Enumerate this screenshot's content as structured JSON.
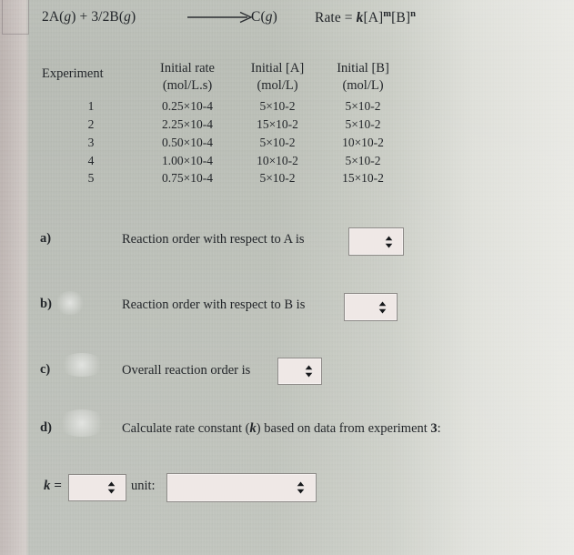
{
  "equation": {
    "reactants": "2A(g) + 3/2B(g)",
    "arrow_icon": "right-arrow-icon",
    "product": "C(g)",
    "rate_law_prefix": "Rate = ",
    "rate_law_k": "k",
    "rate_law_a": "[A]",
    "rate_law_m": "m",
    "rate_law_b": "[B]",
    "rate_law_n": "n"
  },
  "table": {
    "headers": [
      {
        "line1": "Experiment",
        "line2": ""
      },
      {
        "line1": "Initial rate",
        "line2": "(mol/L.s)"
      },
      {
        "line1": "Initial [A]",
        "line2": "(mol/L)"
      },
      {
        "line1": "Initial [B]",
        "line2": "(mol/L)"
      }
    ],
    "rows": [
      {
        "experiment": "1",
        "rate": "0.25×10-4",
        "a": "5×10-2",
        "b": "5×10-2"
      },
      {
        "experiment": "2",
        "rate": "2.25×10-4",
        "a": "15×10-2",
        "b": "5×10-2"
      },
      {
        "experiment": "3",
        "rate": "0.50×10-4",
        "a": "5×10-2",
        "b": "10×10-2"
      },
      {
        "experiment": "4",
        "rate": "1.00×10-4",
        "a": "10×10-2",
        "b": "5×10-2"
      },
      {
        "experiment": "5",
        "rate": "0.75×10-4",
        "a": "5×10-2",
        "b": "15×10-2"
      }
    ]
  },
  "questions": {
    "a": {
      "label": "a)",
      "text": "Reaction order with respect to A is",
      "answer_value": "",
      "answer_placeholder": ""
    },
    "b": {
      "label": "b)",
      "text": "Reaction order with respect to B is",
      "answer_value": "",
      "answer_placeholder": ""
    },
    "c": {
      "label": "c)",
      "text": "Overall reaction order is",
      "answer_value": "",
      "answer_placeholder": ""
    },
    "d": {
      "label": "d)",
      "text_before": "Calculate rate constant (",
      "text_k": "k",
      "text_middle": ") based on data from experiment ",
      "text_experiment": "3",
      "text_after": ":"
    }
  },
  "k_row": {
    "k_equals": "k =",
    "k_value": "",
    "unit_label": "unit:",
    "unit_value": ""
  },
  "icons": {
    "dropdown": "updown-arrows-icon"
  },
  "colors": {
    "page_background": "#b9bdb5",
    "gutter": "#c6bebb",
    "text": "#23262a",
    "field_fill": "#efe8e6",
    "field_border": "#8e8b88"
  }
}
